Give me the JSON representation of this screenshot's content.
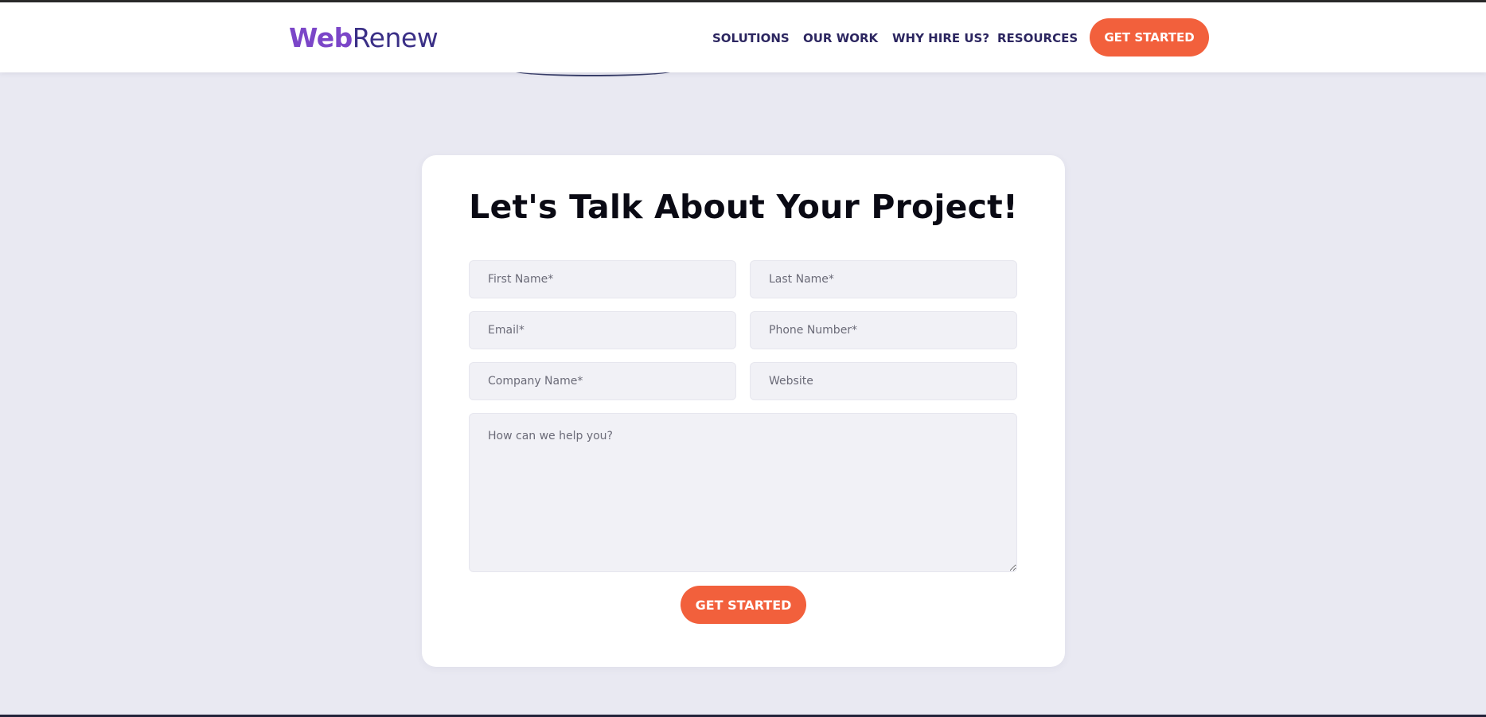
{
  "brand": {
    "logo_part1": "Web",
    "logo_part2": "Renew",
    "primary_color": "#7b46c8",
    "secondary_color": "#3a2f86",
    "accent_color": "#f2603c"
  },
  "nav": {
    "items": [
      {
        "label": "SOLUTIONS"
      },
      {
        "label": "OUR WORK"
      },
      {
        "label": "WHY HIRE US?"
      },
      {
        "label": "RESOURCES"
      }
    ],
    "cta_label": "GET STARTED"
  },
  "form": {
    "title": "Let's Talk About Your Project!",
    "first_name": {
      "placeholder": "First Name*",
      "value": ""
    },
    "last_name": {
      "placeholder": "Last Name*",
      "value": ""
    },
    "email": {
      "placeholder": "Email*",
      "value": ""
    },
    "phone": {
      "placeholder": "Phone Number*",
      "value": ""
    },
    "company": {
      "placeholder": "Company Name*",
      "value": ""
    },
    "website": {
      "placeholder": "Website",
      "value": ""
    },
    "message": {
      "placeholder": "How can we help you?",
      "value": ""
    },
    "submit_label": "GET STARTED"
  }
}
